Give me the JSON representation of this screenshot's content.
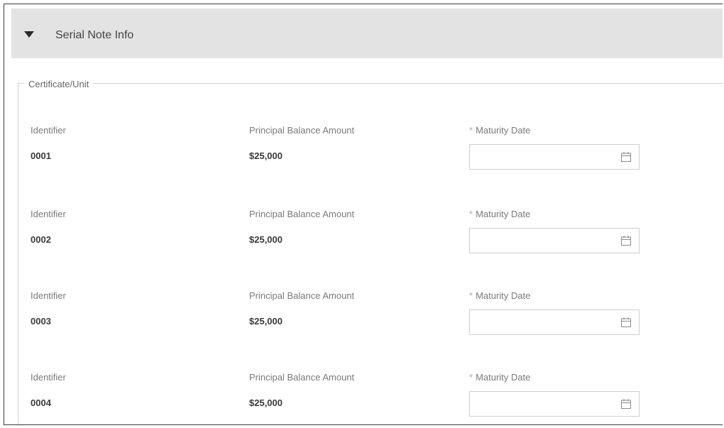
{
  "section": {
    "title": "Serial Note Info",
    "icon": "caret-down-icon",
    "group_legend": "Certificate/Unit"
  },
  "labels": {
    "identifier": "Identifier",
    "principal": "Principal Balance Amount",
    "required_marker": "*",
    "maturity": "Maturity Date"
  },
  "rows": [
    {
      "identifier": "0001",
      "principal": "$25,000",
      "maturity_date": ""
    },
    {
      "identifier": "0002",
      "principal": "$25,000",
      "maturity_date": ""
    },
    {
      "identifier": "0003",
      "principal": "$25,000",
      "maturity_date": ""
    },
    {
      "identifier": "0004",
      "principal": "$25,000",
      "maturity_date": ""
    }
  ],
  "icons": {
    "date_picker": "calendar-icon"
  }
}
